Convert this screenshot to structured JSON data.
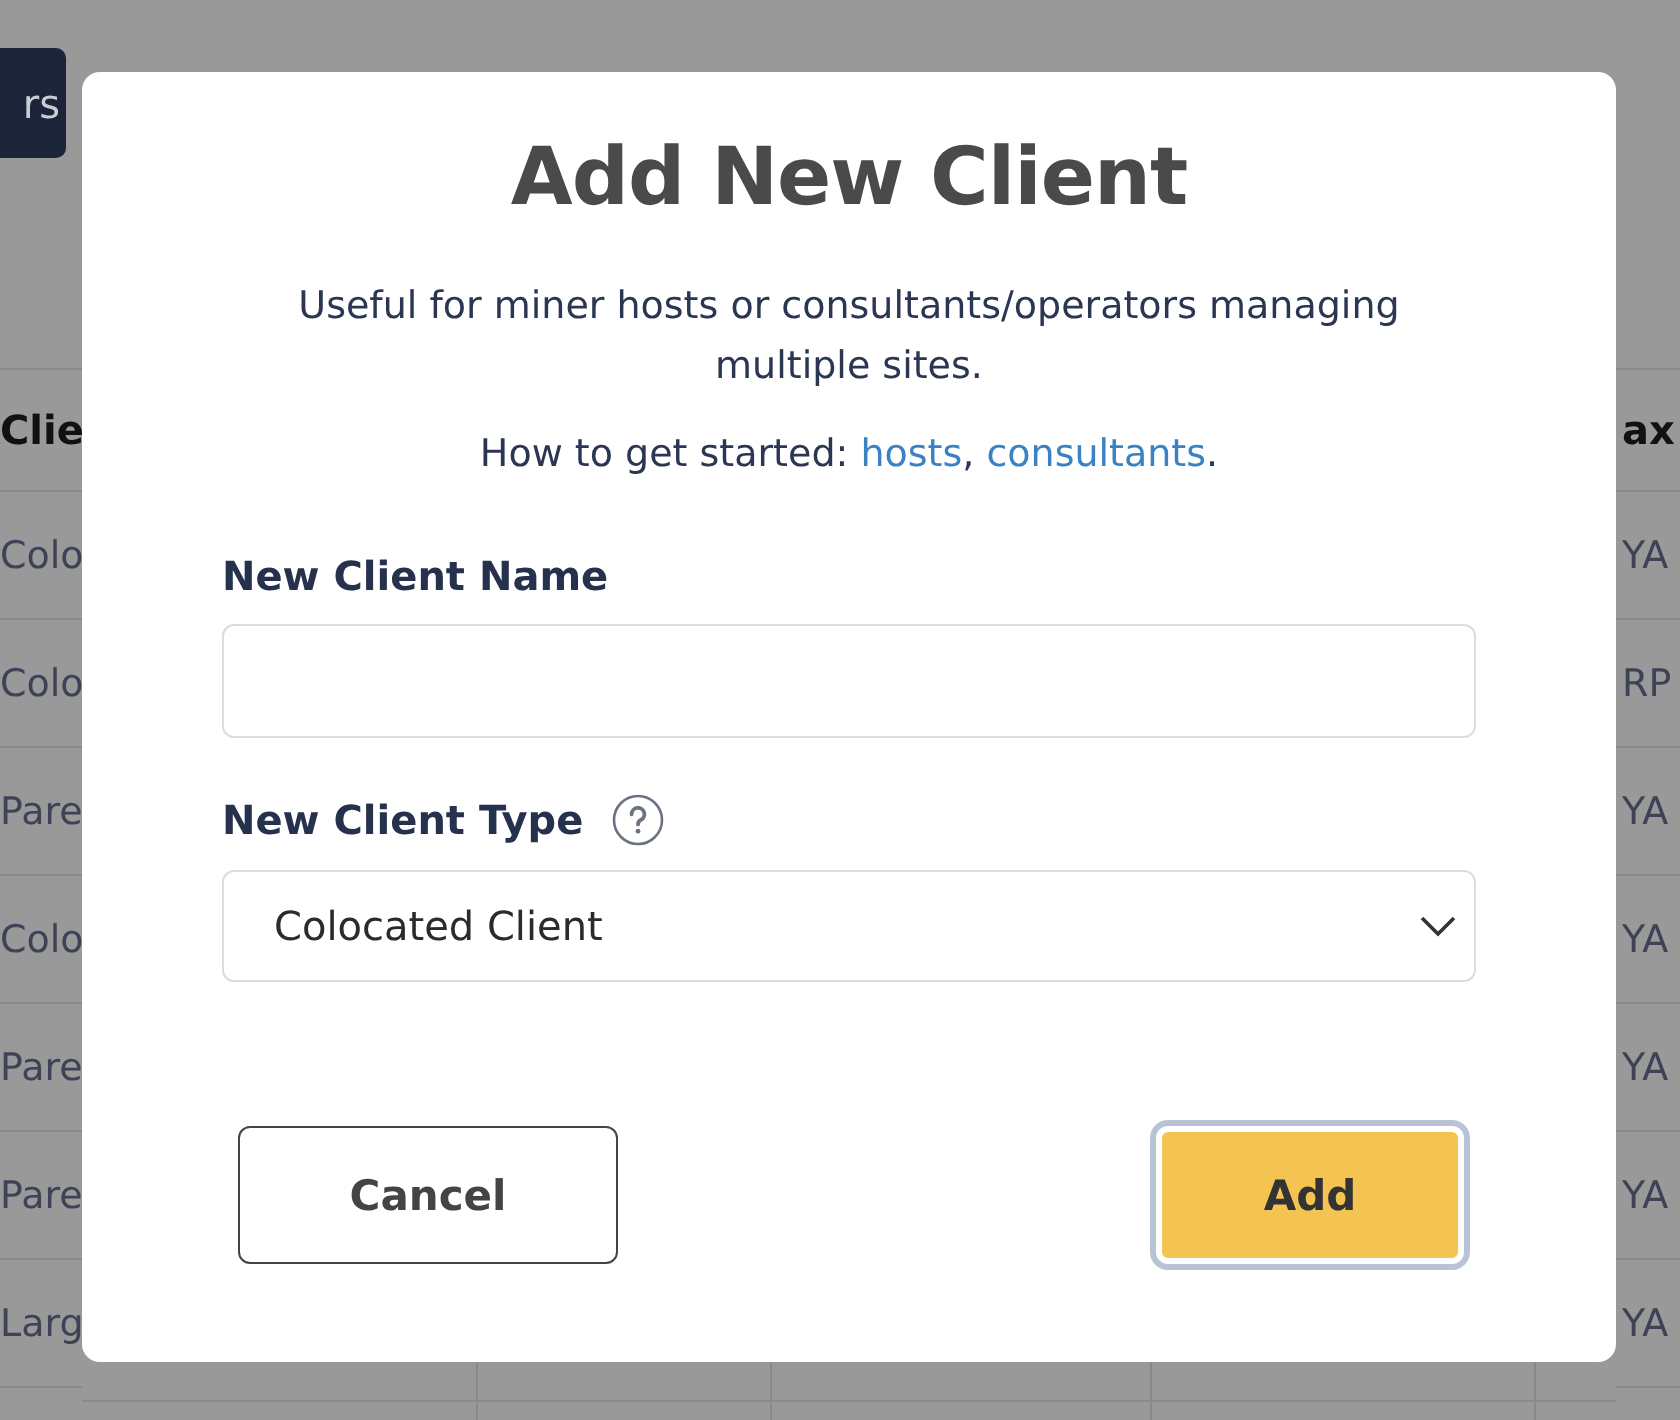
{
  "background": {
    "button": "rs",
    "table": {
      "columns": [
        "Clie",
        "ax"
      ],
      "rows": [
        [
          "Colo",
          "YA"
        ],
        [
          "Colo",
          "RP"
        ],
        [
          "Pare",
          "YA"
        ],
        [
          "Colo",
          "YA"
        ],
        [
          "Pare",
          "YA"
        ],
        [
          "Pare",
          "YA"
        ],
        [
          "Larg",
          "YA"
        ]
      ]
    }
  },
  "dialog": {
    "title": "Add New Client",
    "description": "Useful for miner hosts or consultants/operators managing multiple sites.",
    "getting_started": [
      {
        "kind": "text",
        "text": "How to get started: "
      },
      {
        "kind": "link",
        "text": "hosts"
      },
      {
        "kind": "text",
        "text": ", "
      },
      {
        "kind": "link",
        "text": "consultants"
      },
      {
        "kind": "text",
        "text": "."
      }
    ],
    "name_field": {
      "label": "New Client Name"
    },
    "type_field": {
      "label": "New Client Type",
      "value": "Colocated Client"
    },
    "buttons": [
      {
        "label": "Cancel",
        "kind": "secondary",
        "focused": false
      },
      {
        "label": "Add",
        "kind": "primary",
        "focused": true
      }
    ]
  }
}
